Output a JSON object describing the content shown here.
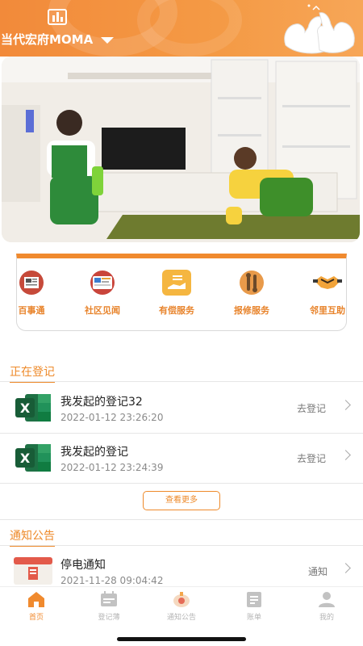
{
  "header": {
    "community_name": "当代宏府MOMA"
  },
  "services": [
    {
      "label": "百事通",
      "icon": "newspaper-icon"
    },
    {
      "label": "社区见闻",
      "icon": "screen-icon"
    },
    {
      "label": "有偿服务",
      "icon": "service-hand-icon"
    },
    {
      "label": "报修服务",
      "icon": "tools-icon"
    },
    {
      "label": "邻里互助",
      "icon": "handshake-icon"
    }
  ],
  "registering": {
    "title": "正在登记",
    "items": [
      {
        "title": "我发起的登记32",
        "time": "2022-01-12 23:26:20",
        "action": "去登记"
      },
      {
        "title": "我发起的登记",
        "time": "2022-01-12 23:24:39",
        "action": "去登记"
      }
    ],
    "more_label": "查看更多"
  },
  "notices": {
    "title": "通知公告",
    "items": [
      {
        "title": "停电通知",
        "time": "2021-11-28 09:04:42",
        "action": "通知"
      }
    ]
  },
  "tabbar": [
    {
      "label": "首页",
      "icon": "home-icon",
      "active": true
    },
    {
      "label": "登记薄",
      "icon": "register-icon",
      "active": false
    },
    {
      "label": "通知公告",
      "icon": "notice-icon",
      "active": false
    },
    {
      "label": "账单",
      "icon": "bill-icon",
      "active": false
    },
    {
      "label": "我的",
      "icon": "profile-icon",
      "active": false
    }
  ],
  "colors": {
    "accent": "#F08A2E",
    "header_gradient_start": "#F28A3A",
    "header_gradient_end": "#F7A657"
  }
}
